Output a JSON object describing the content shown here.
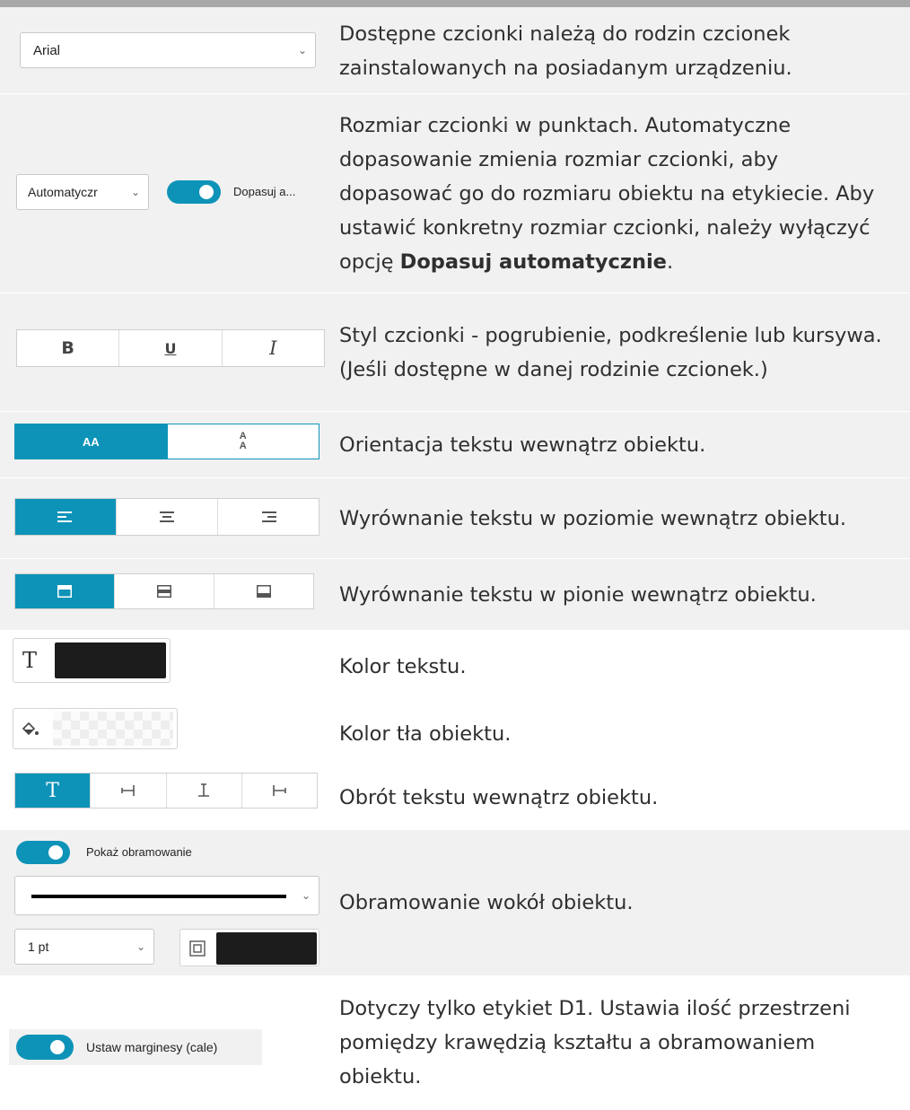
{
  "font_family": {
    "select_value": "Arial",
    "description": "Dostępne czcionki należą do rodzin czcionek zainstalowanych na posiadanym urządzeniu."
  },
  "font_size": {
    "select_value": "Automatyczr",
    "toggle_label": "Dopasuj a...",
    "description_part1": "Rozmiar czcionki w punktach. Automatyczne dopasowanie zmienia rozmiar czcionki, aby dopasować go do rozmiaru obiektu na etykiecie. Aby ustawić konkretny rozmiar czcionki, należy wyłączyć opcję ",
    "description_bold": "Dopasuj automatycznie",
    "description_part2": "."
  },
  "font_style": {
    "buttons": [
      "B",
      "U",
      "I"
    ],
    "description": "Styl czcionki - pogrubienie, podkreślenie lub kursywa. (Jeśli dostępne w danej rodzinie czcionek.)"
  },
  "orientation": {
    "horizontal_label": "AA",
    "vertical_label_top": "A",
    "vertical_label_bottom": "A",
    "description": "Orientacja tekstu wewnątrz obiektu."
  },
  "horizontal_alignment": {
    "description": "Wyrównanie tekstu w poziomie wewnątrz obiektu."
  },
  "vertical_alignment": {
    "description": "Wyrównanie tekstu w pionie wewnątrz obiektu."
  },
  "text_color": {
    "icon_glyph": "T",
    "color": "#1c1c1c",
    "description": "Kolor tekstu."
  },
  "background_color": {
    "description": "Kolor tła obiektu."
  },
  "rotation": {
    "selected_glyph": "T",
    "description": "Obrót tekstu wewnątrz obiektu."
  },
  "border": {
    "toggle_label": "Pokaż obramowanie",
    "width_value": "1 pt",
    "color": "#1c1c1c",
    "description": "Obramowanie wokół obiektu."
  },
  "margins": {
    "toggle_label": "Ustaw marginesy (cale)",
    "description": "Dotyczy tylko etykiet D1. Ustawia ilość przestrzeni pomiędzy krawędzią kształtu a obramowaniem obiektu."
  },
  "colors": {
    "accent": "#0e93b8",
    "row_shade": "#f1f1f1"
  }
}
